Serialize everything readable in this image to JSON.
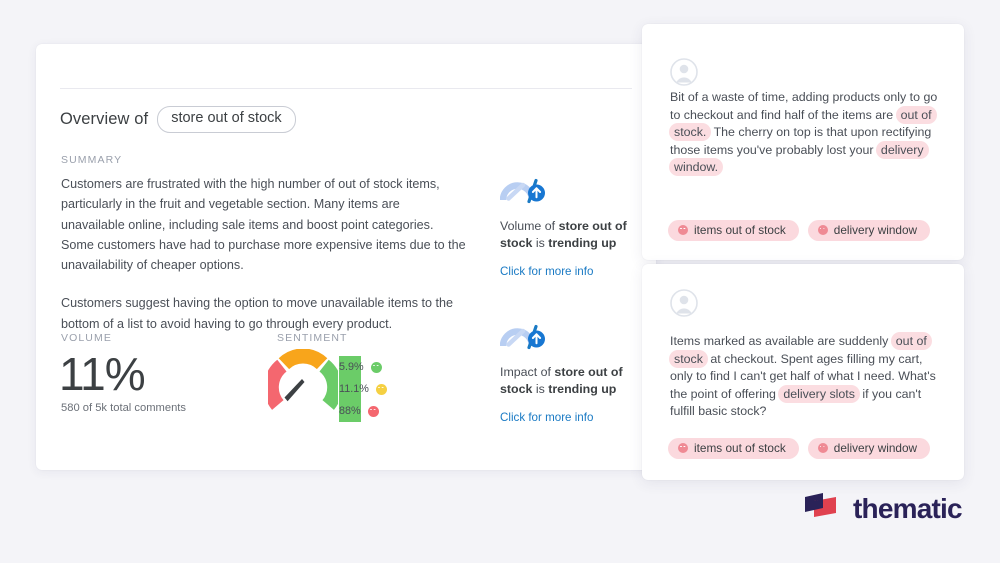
{
  "theme": {
    "bg": "#f4f4f8",
    "card_bg": "#ffffff",
    "link_color": "#1a7ac4",
    "highlight_bg": "#fbdde1",
    "tag_bg": "#fbd9de",
    "positive_color": "#6bcc68",
    "neutral_color": "#f8a51b",
    "negative_color": "#f4676f",
    "logo_navy": "#2a2258",
    "logo_red": "#e0414f"
  },
  "overview": {
    "title_prefix": "Overview of",
    "theme_pill": "store out of stock",
    "summary_label": "SUMMARY",
    "summary_paragraphs": [
      "Customers are frustrated with the high number of out of stock items, particularly in the fruit and vegetable section. Many items are unavailable online, including sale items and boost point categories. Some customers have had to purchase more expensive items due to the unavailability of cheaper options.",
      "Customers suggest having the option to move unavailable items to the bottom of a list to avoid having to go through every product."
    ],
    "volume_label": "VOLUME",
    "volume_value": "11%",
    "volume_sub": "580 of 5k total comments",
    "sentiment_label": "SENTIMENT"
  },
  "chart_data": {
    "type": "bar",
    "title": "SENTIMENT",
    "categories": [
      "Positive",
      "Neutral",
      "Negative"
    ],
    "values": [
      5.9,
      11.1,
      88
    ],
    "labels": [
      "5.9%",
      "11.1%",
      "88%"
    ],
    "colors": [
      "#6bcc68",
      "#f8a51b",
      "#f4676f"
    ],
    "xlabel": "",
    "ylabel": "",
    "xlim": [
      0,
      100
    ],
    "orientation": "horizontal",
    "grid": false,
    "legend": "none",
    "gauge": {
      "type": "gauge",
      "needle_value": 88,
      "needle_zone": "negative",
      "segments": [
        {
          "name": "negative",
          "color": "#f4676f",
          "span_deg": 60
        },
        {
          "name": "neutral",
          "color": "#f8a51b",
          "span_deg": 60
        },
        {
          "name": "positive",
          "color": "#6bcc68",
          "span_deg": 60
        }
      ]
    }
  },
  "trending": [
    {
      "icon": "speedometer-trending-up-icon",
      "prefix": "Volume of",
      "subject": "store out of stock",
      "suffix_lead": "is",
      "suffix_bold": "trending up",
      "link": "Click for more info"
    },
    {
      "icon": "speedometer-trending-up-icon",
      "prefix": "Impact of",
      "subject": "store out of stock",
      "suffix_lead": "is",
      "suffix_bold": "trending up",
      "link": "Click for more info"
    }
  ],
  "comments": [
    {
      "avatar": "user-avatar-icon",
      "segments": [
        {
          "t": "Bit of a waste of time, adding products only to go to checkout and find half of the items are ",
          "h": false
        },
        {
          "t": "out of stock.",
          "h": true
        },
        {
          "t": " The cherry on top is that upon rectifying those items you've probably lost your ",
          "h": false
        },
        {
          "t": "delivery window.",
          "h": true
        }
      ],
      "tags": [
        "items out of stock",
        "delivery window"
      ]
    },
    {
      "avatar": "user-avatar-icon",
      "segments": [
        {
          "t": "Items marked as available are suddenly ",
          "h": false
        },
        {
          "t": "out of stock",
          "h": true
        },
        {
          "t": " at checkout. Spent ages filling my cart, only to find I can't get half of what I need. What's the point of offering ",
          "h": false
        },
        {
          "t": "delivery slots",
          "h": true
        },
        {
          "t": " if you can't fulfill basic stock?",
          "h": false
        }
      ],
      "tags": [
        "items out of stock",
        "delivery window"
      ]
    }
  ],
  "logo": {
    "text": "thematic",
    "mark": "thematic-logo-mark"
  }
}
